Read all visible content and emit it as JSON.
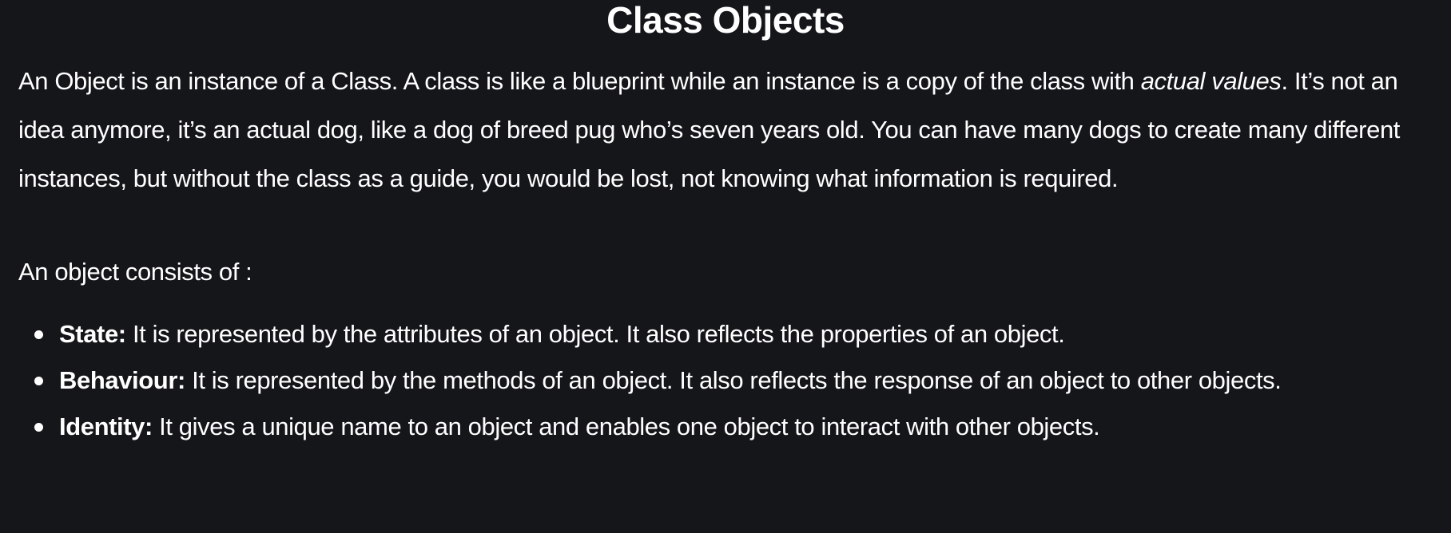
{
  "title": "Class Objects",
  "paragraph": {
    "part1": "An Object is an instance of a Class. A class is like a blueprint while an instance is a copy of the class with ",
    "emphasis": "actual values",
    "part2": ". It’s not an idea anymore, it’s an actual dog, like a dog of breed pug who’s seven years old. You can have many dogs to create many different instances, but without the class as a guide, you would be lost, not knowing what information is required."
  },
  "intro": "An object consists of :",
  "items": [
    {
      "term": "State:",
      "text": " It is represented by the attributes of an object. It also reflects the properties of an object."
    },
    {
      "term": "Behaviour:",
      "text": " It is represented by the methods of an object. It also reflects the response of an object to other objects."
    },
    {
      "term": "Identity:",
      "text": " It gives a unique name to an object and enables one object to interact with other objects."
    }
  ]
}
